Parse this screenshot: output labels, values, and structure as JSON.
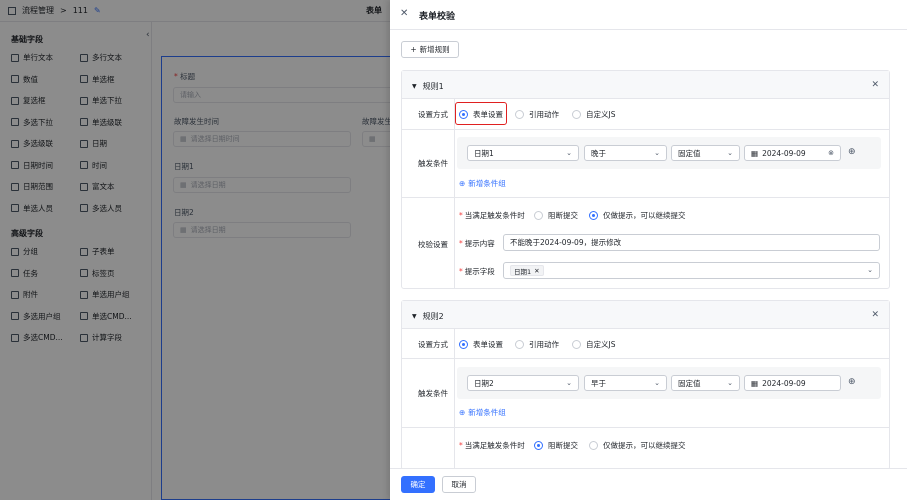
{
  "topbar": {
    "crumb": "流程管理",
    "sep": ">",
    "name": "111",
    "tab": "表单"
  },
  "left": {
    "basic_title": "基础字段",
    "basic": [
      "单行文本",
      "多行文本",
      "数值",
      "单选框",
      "复选框",
      "单选下拉",
      "多选下拉",
      "单选级联",
      "多选级联",
      "日期",
      "日期时间",
      "时间",
      "日期范围",
      "富文本",
      "单选人员",
      "多选人员"
    ],
    "adv_title": "高级字段",
    "adv": [
      "分组",
      "子表单",
      "任务",
      "标签页",
      "附件",
      "单选用户组",
      "多选用户组",
      "单选CMD...",
      "多选CMD...",
      "计算字段"
    ]
  },
  "canvas": {
    "title_label": "标题",
    "title_ph": "请输入",
    "f1_label": "故障发生时间",
    "f1_ph": "请选择日期时间",
    "f1b_label": "故障发生",
    "d1_label": "日期1",
    "d1_ph": "请选择日期",
    "d2_label": "日期2",
    "d2_ph": "请选择日期"
  },
  "drawer": {
    "title": "表单校验",
    "add_rule": "新增规则",
    "rules": [
      {
        "name": "规则1",
        "mode_label": "设置方式",
        "modes": [
          "表单设置",
          "引用动作",
          "自定义JS"
        ],
        "mode_selected": 0,
        "trigger_label": "触发条件",
        "cond": {
          "field": "日期1",
          "op": "晚于",
          "type": "固定值",
          "value": "2024-09-09"
        },
        "add_cond": "新增条件组",
        "check_label": "校验设置",
        "when_label": "当满足触发条件时",
        "when_opts": [
          "阻断提交",
          "仅做提示，可以继续提交"
        ],
        "when_selected": 1,
        "msg_label": "提示内容",
        "msg_value": "不能晚于2024-09-09，提示修改",
        "fields_label": "提示字段",
        "fields_tags": [
          "日期1"
        ]
      },
      {
        "name": "规则2",
        "mode_label": "设置方式",
        "modes": [
          "表单设置",
          "引用动作",
          "自定义JS"
        ],
        "mode_selected": 0,
        "trigger_label": "触发条件",
        "cond": {
          "field": "日期2",
          "op": "早于",
          "type": "固定值",
          "value": "2024-09-09"
        },
        "add_cond": "新增条件组",
        "when_label": "当满足触发条件时",
        "when_opts": [
          "阻断提交",
          "仅做提示，可以继续提交"
        ],
        "when_selected": 0
      }
    ],
    "ok": "确定",
    "cancel": "取消"
  }
}
